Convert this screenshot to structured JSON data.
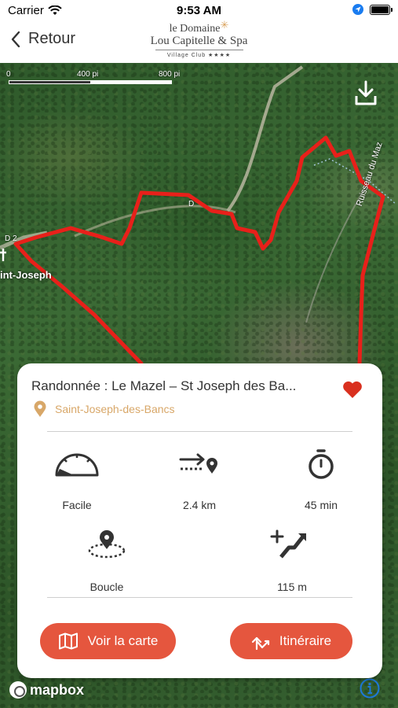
{
  "status_bar": {
    "carrier": "Carrier",
    "time": "9:53 AM"
  },
  "nav": {
    "back_label": "Retour",
    "brand": {
      "line1": "le Domaine",
      "line2": "Lou Capitelle & Spa",
      "line3": "Village Club ★★★★"
    }
  },
  "map": {
    "scale_labels": [
      "0",
      "400 pi",
      "800 pi"
    ],
    "road_labels": [
      "D 2",
      "D"
    ],
    "place_label": "int-Joseph",
    "stream_label": "Ruisseau du Maz",
    "attribution": "mapbox",
    "route_color": "#e8201a"
  },
  "card": {
    "title": "Randonnée : Le Mazel – St Joseph des Ba...",
    "location": "Saint-Joseph-des-Bancs",
    "stats": {
      "difficulty": "Facile",
      "distance": "2.4 km",
      "duration": "45 min",
      "loop": "Boucle",
      "elevation": "115 m"
    },
    "buttons": {
      "map": "Voir la carte",
      "route": "Itinéraire"
    },
    "favorited": true
  },
  "colors": {
    "accent": "#e5563e",
    "location": "#d8a768",
    "heart": "#d9301f"
  },
  "icons": {
    "back": "chevron-left-icon",
    "download": "download-icon",
    "heart": "heart-icon",
    "location": "map-pin-icon",
    "difficulty": "gauge-icon",
    "distance": "distance-icon",
    "duration": "stopwatch-icon",
    "loop": "loop-icon",
    "elevation": "elevation-icon",
    "map_button": "map-icon",
    "route_button": "route-icon",
    "info": "info-icon"
  }
}
